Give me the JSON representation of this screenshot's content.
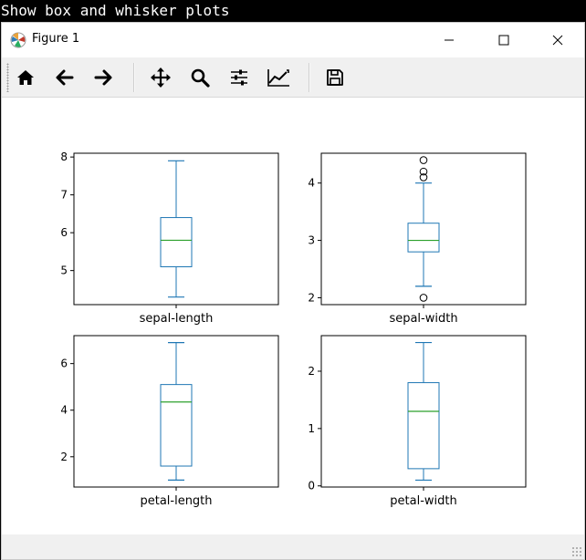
{
  "terminal": {
    "title": "Show box and whisker plots"
  },
  "window": {
    "title": "Figure 1",
    "icon": "matplotlib-logo-icon",
    "controls": [
      "minimize-icon",
      "maximize-icon",
      "close-icon"
    ]
  },
  "toolbar": {
    "buttons": [
      {
        "name": "home-button",
        "icon": "home-icon"
      },
      {
        "name": "back-button",
        "icon": "arrow-left-icon"
      },
      {
        "name": "forward-button",
        "icon": "arrow-right-icon"
      },
      {
        "name": "pan-button",
        "icon": "move-icon"
      },
      {
        "name": "zoom-button",
        "icon": "magnifier-icon"
      },
      {
        "name": "configure-subplots-button",
        "icon": "sliders-icon"
      },
      {
        "name": "edit-axis-button",
        "icon": "line-chart-icon"
      },
      {
        "name": "save-button",
        "icon": "floppy-disk-icon"
      }
    ]
  },
  "colors": {
    "box": "#1f77b4",
    "median": "#2ca02c",
    "outlier": "#000000"
  },
  "chart_data": [
    {
      "type": "box",
      "categories": [
        "sepal-length"
      ],
      "box": {
        "whislo": 4.3,
        "q1": 5.1,
        "med": 5.8,
        "q3": 6.4,
        "whishi": 7.9
      },
      "fliers": [],
      "yticks": [
        5,
        6,
        7,
        8
      ],
      "ylim": [
        4.1,
        8.1
      ]
    },
    {
      "type": "box",
      "categories": [
        "sepal-width"
      ],
      "box": {
        "whislo": 2.2,
        "q1": 2.8,
        "med": 3.0,
        "q3": 3.3,
        "whishi": 4.0
      },
      "fliers": [
        4.4,
        4.1,
        4.2,
        2.0
      ],
      "yticks": [
        2,
        3,
        4
      ],
      "ylim": [
        1.88,
        4.52
      ]
    },
    {
      "type": "box",
      "categories": [
        "petal-length"
      ],
      "box": {
        "whislo": 1.0,
        "q1": 1.6,
        "med": 4.35,
        "q3": 5.1,
        "whishi": 6.9
      },
      "fliers": [],
      "yticks": [
        2,
        4,
        6
      ],
      "ylim": [
        0.7,
        7.2
      ]
    },
    {
      "type": "box",
      "categories": [
        "petal-width"
      ],
      "box": {
        "whislo": 0.1,
        "q1": 0.3,
        "med": 1.3,
        "q3": 1.8,
        "whishi": 2.5
      },
      "fliers": [],
      "yticks": [
        0,
        1,
        2
      ],
      "ylim": [
        -0.02,
        2.62
      ]
    }
  ]
}
